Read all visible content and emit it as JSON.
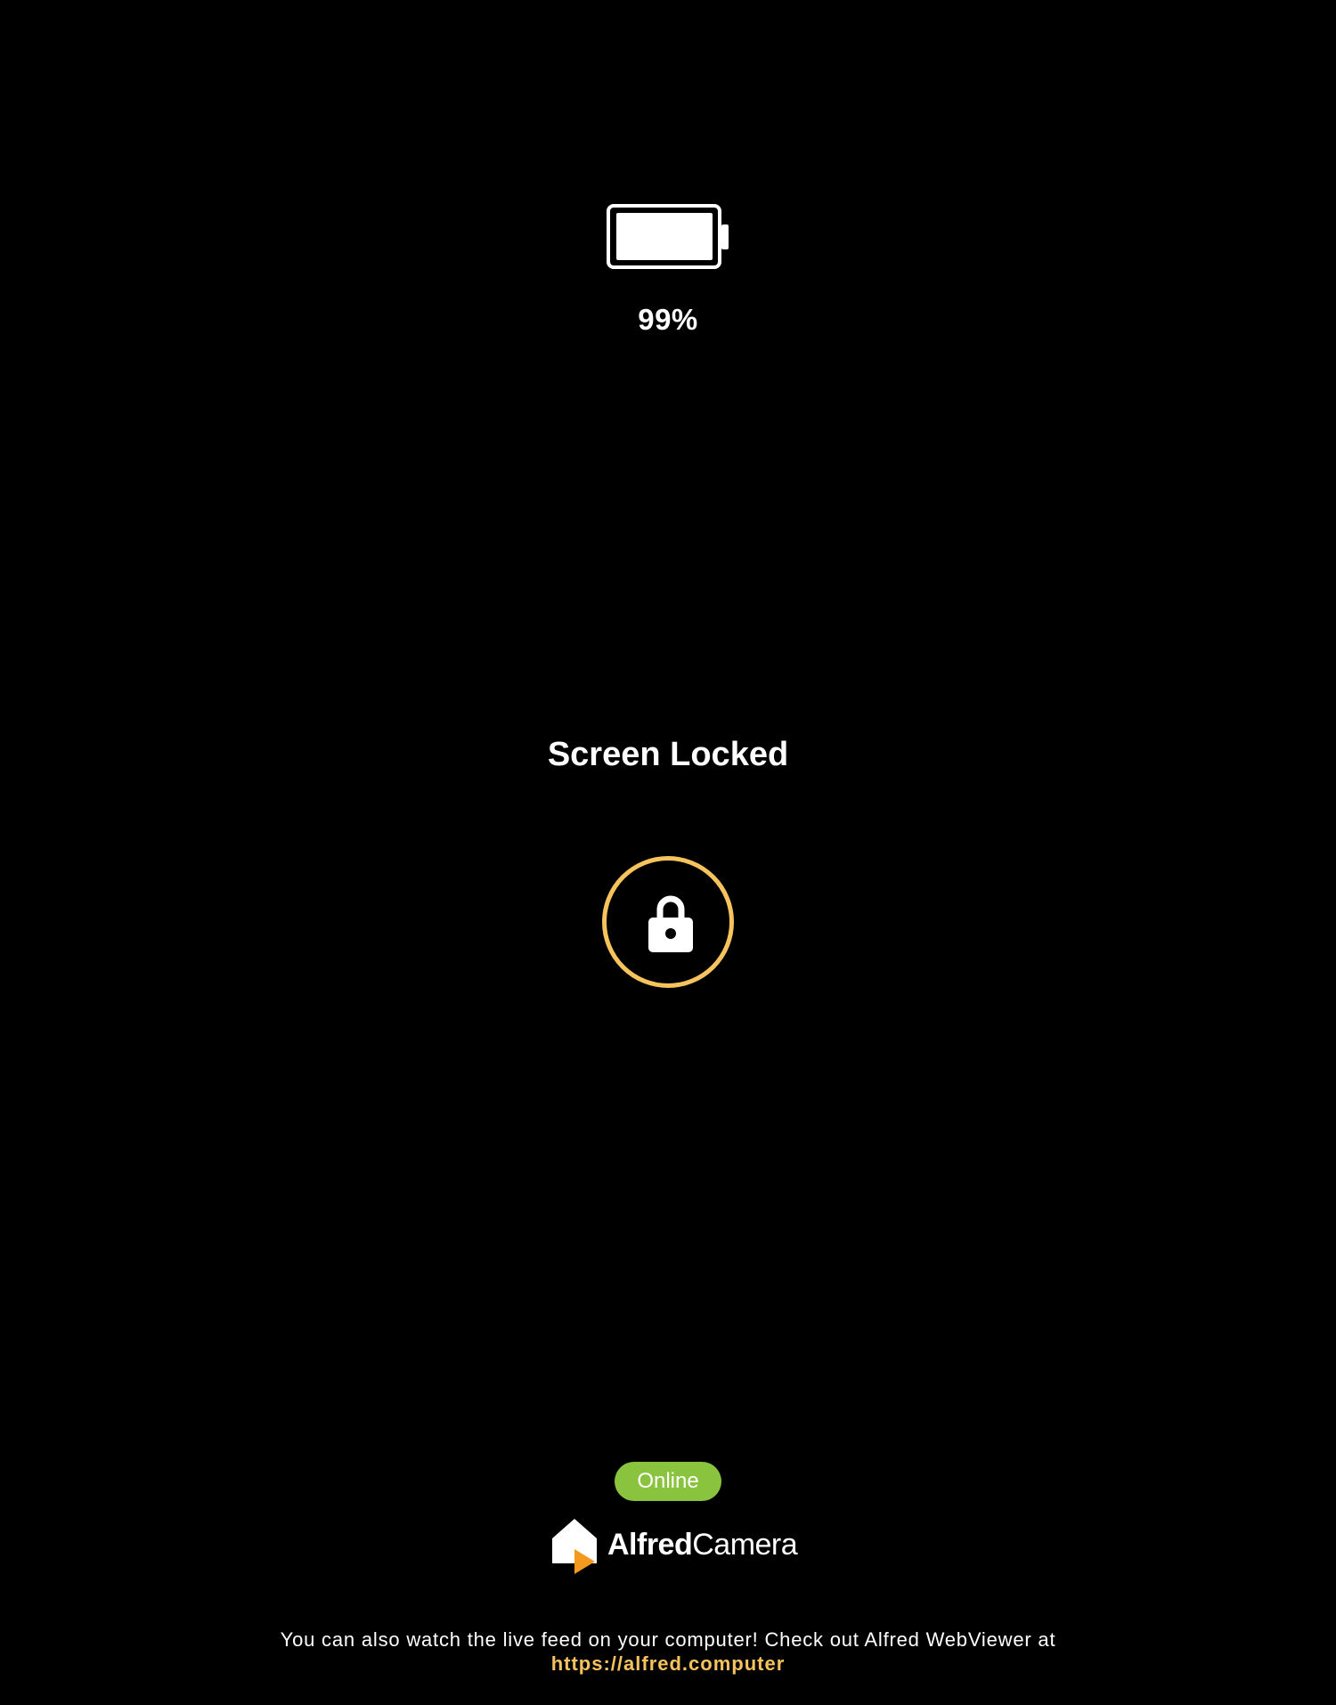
{
  "battery": {
    "icon": "battery-full-icon",
    "level": 0.99,
    "percent_label": "99%"
  },
  "lock_screen": {
    "title": "Screen Locked",
    "lock_icon": "lock-icon"
  },
  "status": {
    "label": "Online",
    "color": "#8AC43F"
  },
  "brand": {
    "name_part1": "Alfred",
    "name_part2": "Camera",
    "logo_icon": "alfred-house-logo",
    "accent_color": "#F39A1E"
  },
  "footer": {
    "message": "You can also watch the live feed on your computer! Check out Alfred WebViewer at",
    "link_text": "https://alfred.computer",
    "link_color": "#F7C35C"
  },
  "theme": {
    "background": "#000000",
    "ring_color": "#F7C35C"
  }
}
